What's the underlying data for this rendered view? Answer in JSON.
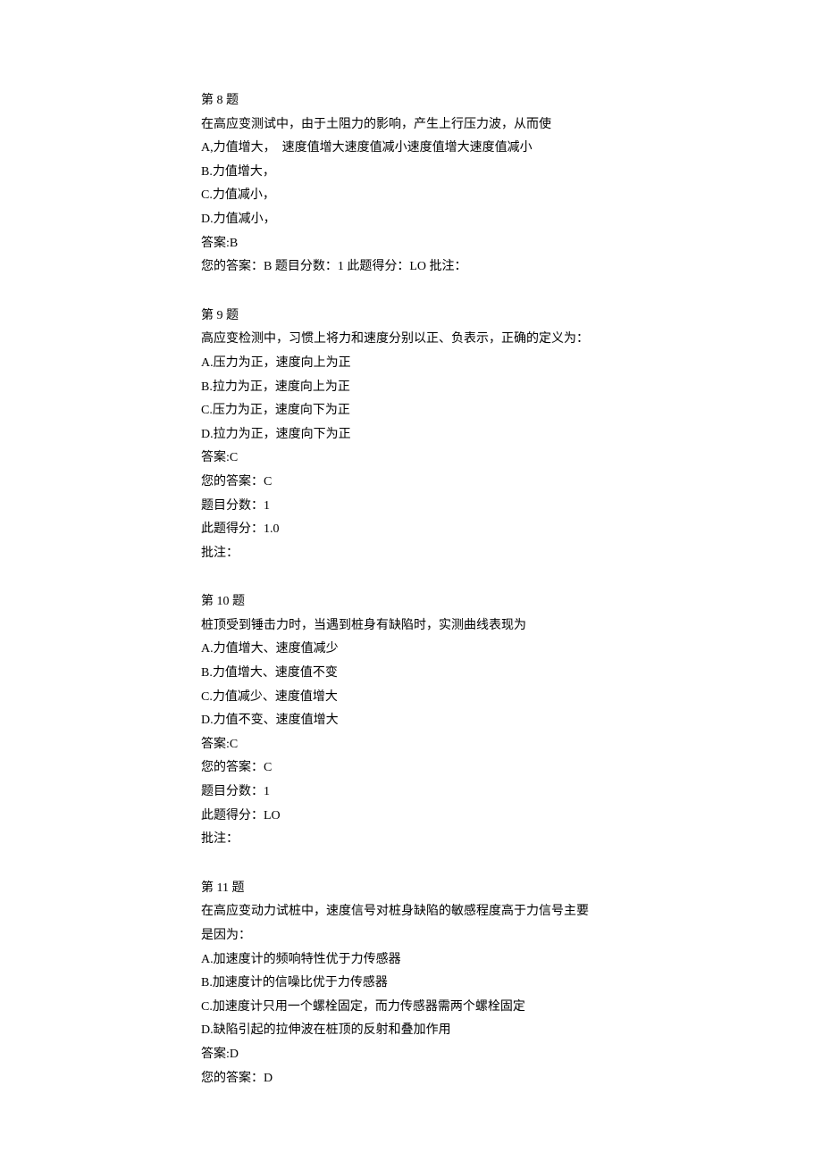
{
  "questions": [
    {
      "header": "第 8 题",
      "stem": "在高应变测试中，由于土阻力的影响，产生上行压力波，从而使",
      "options": [
        "A,力值增大，  速度值增大速度值减小速度值增大速度值减小",
        "B.力值增大，",
        "C.力值减小，",
        "D.力值减小，"
      ],
      "answer": "答案:B",
      "footer": [
        "您的答案：B 题目分数：1 此题得分：LO 批注："
      ]
    },
    {
      "header": "第 9 题",
      "stem": "高应变检测中，习惯上将力和速度分别以正、负表示，正确的定义为：",
      "options": [
        "A.压力为正，速度向上为正",
        "B.拉力为正，速度向上为正",
        "C.压力为正，速度向下为正",
        "D.拉力为正，速度向下为正"
      ],
      "answer": "答案:C",
      "footer": [
        "您的答案：C",
        "题目分数：1",
        "此题得分：1.0",
        "批注："
      ]
    },
    {
      "header": "第 10 题",
      "stem": "桩顶受到锤击力时，当遇到桩身有缺陷时，实测曲线表现为",
      "options": [
        "A.力值增大、速度值减少",
        "B.力值增大、速度值不变",
        "C.力值减少、速度值增大",
        "D.力值不变、速度值增大"
      ],
      "answer": "答案:C",
      "footer": [
        "您的答案：C",
        "题目分数：1",
        "此题得分：LO",
        "批注："
      ]
    },
    {
      "header": "第 11 题",
      "stem": "在高应变动力试桩中，速度信号对桩身缺陷的敏感程度高于力信号主要",
      "stem2": "是因为：",
      "options": [
        "A.加速度计的频响特性优于力传感器",
        "B.加速度计的信噪比优于力传感器",
        "C.加速度计只用一个螺栓固定，而力传感器需两个螺栓固定",
        "D.缺陷引起的拉伸波在桩顶的反射和叠加作用"
      ],
      "answer": "答案:D",
      "footer": [
        "您的答案：D"
      ]
    }
  ]
}
